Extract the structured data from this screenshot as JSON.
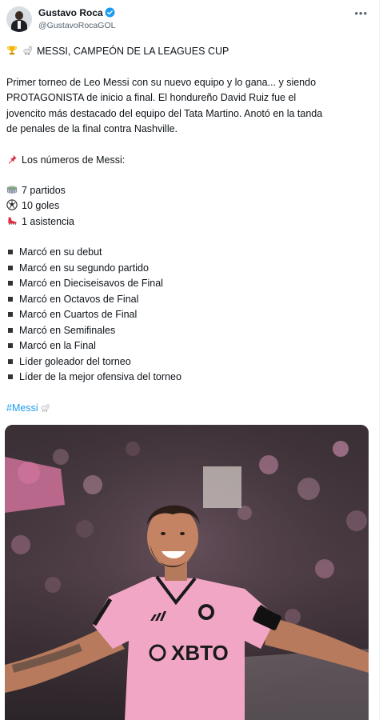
{
  "author": {
    "name": "Gustavo Roca",
    "handle": "@GustavoRocaGOL"
  },
  "post": {
    "title_line": "MESSI, CAMPEÓN DE LA LEAGUES CUP",
    "paragraph_lines": [
      "Primer torneo de Leo Messi con su nuevo equipo y lo gana... y siendo",
      "PROTAGONISTA de inicio a final. El hondureño David Ruiz fue el",
      "jovencito más destacado del equipo del Tata Martino. Anotó en la tanda",
      "de penales de la final contra Nashville."
    ],
    "numbers_heading": "Los números de Messi:",
    "stats": [
      "7 partidos",
      "10 goles",
      "1 asistencia"
    ],
    "achievements": [
      "Marcó en su debut",
      "Marcó en su segundo partido",
      "Marcó en Dieciseisavos de Final",
      "Marcó en Octavos de Final",
      "Marcó en Cuartos de Final",
      "Marcó en Semifinales",
      "Marcó en la Final",
      "Líder goleador del torneo",
      "Líder de la mejor ofensiva del torneo"
    ],
    "hashtag": "#Messi"
  },
  "photo": {
    "jersey_sponsor": "XBTO"
  },
  "colors": {
    "link": "#1d9bf0",
    "secondary_text": "#536471",
    "jersey_pink": "#f2a6c6"
  }
}
